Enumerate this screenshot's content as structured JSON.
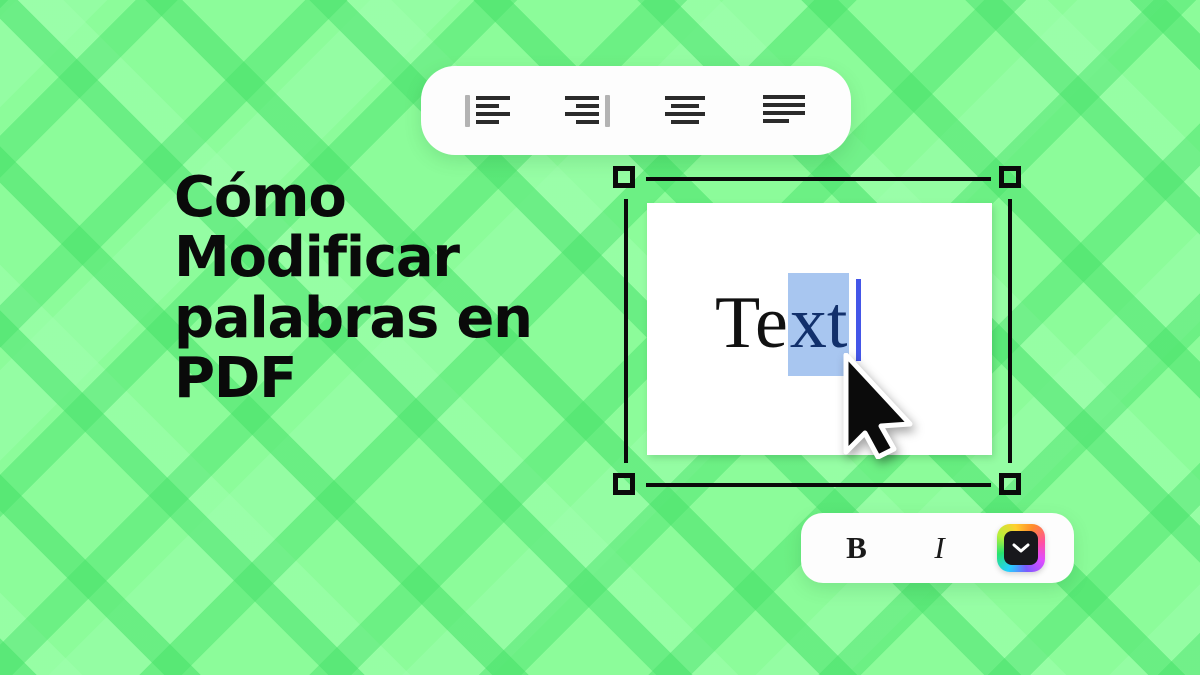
{
  "theme": {
    "background_green": "#8cfc9a",
    "stripe_green": "#6bee7d",
    "toolbar_white": "#fdfdfd",
    "selection_blue": "#a8c6f0",
    "selected_text_navy": "#12306b",
    "caret_blue": "#4456e8",
    "handle_black": "#0a0a0a"
  },
  "headline": {
    "text": "Cómo\nModificar\npalabras en\nPDF",
    "color": "#0a0a0a"
  },
  "alignment_toolbar": {
    "name": "text-alignment-toolbar",
    "buttons": [
      {
        "id": "align-left",
        "label": "Align left",
        "icon": "align-left-icon"
      },
      {
        "id": "align-right",
        "label": "Align right",
        "icon": "align-right-icon"
      },
      {
        "id": "align-center",
        "label": "Align center",
        "icon": "align-center-icon"
      },
      {
        "id": "align-justify",
        "label": "Justify",
        "icon": "align-justify-icon"
      }
    ]
  },
  "text_box": {
    "name": "selected-text-box",
    "content_unselected": "Te",
    "content_selected": "xt",
    "caret_visible": true,
    "handles": [
      {
        "id": "handle-top-left",
        "label": "Top-left resize handle"
      },
      {
        "id": "handle-top-right",
        "label": "Top-right resize handle"
      },
      {
        "id": "handle-bottom-left",
        "label": "Bottom-left resize handle"
      },
      {
        "id": "handle-bottom-right",
        "label": "Bottom-right resize handle"
      }
    ],
    "cursor_icon": "mouse-pointer-icon"
  },
  "format_toolbar": {
    "name": "text-format-toolbar",
    "bold_label": "B",
    "italic_label": "I",
    "color_picker": {
      "label": "Text color",
      "icon": "chevron-down-icon",
      "swatch": "#18181c"
    }
  }
}
